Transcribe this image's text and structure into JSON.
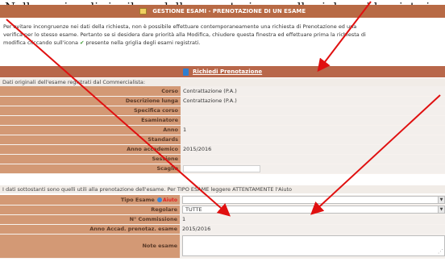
{
  "caption": "Nella pagina di riepilogo della prenotazione, nelle righe evidenziate in rosso, il sistema indica",
  "window": {
    "title": "GESTIONE ESAMI - PRENOTAZIONE DI UN ESAME"
  },
  "notice": {
    "line1": "Per evitare incongruenze nei dati della richiesta, non è possibile effettuare contemporaneamente una richiesta di Prenotazione ed una",
    "line2": "verifica per lo stesso esame. Pertanto se si desidera dare priorità alla Modifica, chiudere questa finestra ed effettuare prima la richiesta di",
    "line3": "modifica cliccando sull'icona",
    "line3_end": "presente nella griglia degli esami registrati."
  },
  "section": {
    "link": "Richiedi Prenotazione"
  },
  "info_row": "Dati originali dell'esame registrati dal Commercialista:",
  "fields": [
    {
      "label": "Corso",
      "value": "Contrattazione (P.A.)"
    },
    {
      "label": "Descrizione lunga",
      "value": "Contrattazione (P.A.)"
    },
    {
      "label": "Specifica corso",
      "value": ""
    },
    {
      "label": "Esaminatore",
      "value": ""
    },
    {
      "label": "Anno",
      "value": "1"
    },
    {
      "label": "Standards",
      "value": ""
    },
    {
      "label": "Anno accademico",
      "value": "2015/2016"
    },
    {
      "label": "Sessione",
      "value": ""
    },
    {
      "label": "Scaglio",
      "value": ""
    }
  ],
  "second_info": "I dati sottostanti sono quelli utili alla prenotazione dell'esame. Per TIPO ESAME leggere ATTENTAMENTE l'Aiuto",
  "form2": {
    "tipo_esame_label": "Tipo Esame",
    "aiuto_label": "Aiuto",
    "tipo_esame_value": "",
    "regolare_label": "Regolare",
    "regolare_value": "TUTTE",
    "n_commissione_label": "N° Commissione",
    "n_commissione_value": "1",
    "anno_accad_label": "Anno Accad. prenotaz. esame",
    "anno_accad_value": "2015/2016",
    "note_label": "Note esame",
    "note_value": ""
  },
  "colors": {
    "title_bar": "#b86a45",
    "label_bg": "#d39975",
    "value_bg": "#f3efec",
    "arrow": "#e01010"
  }
}
